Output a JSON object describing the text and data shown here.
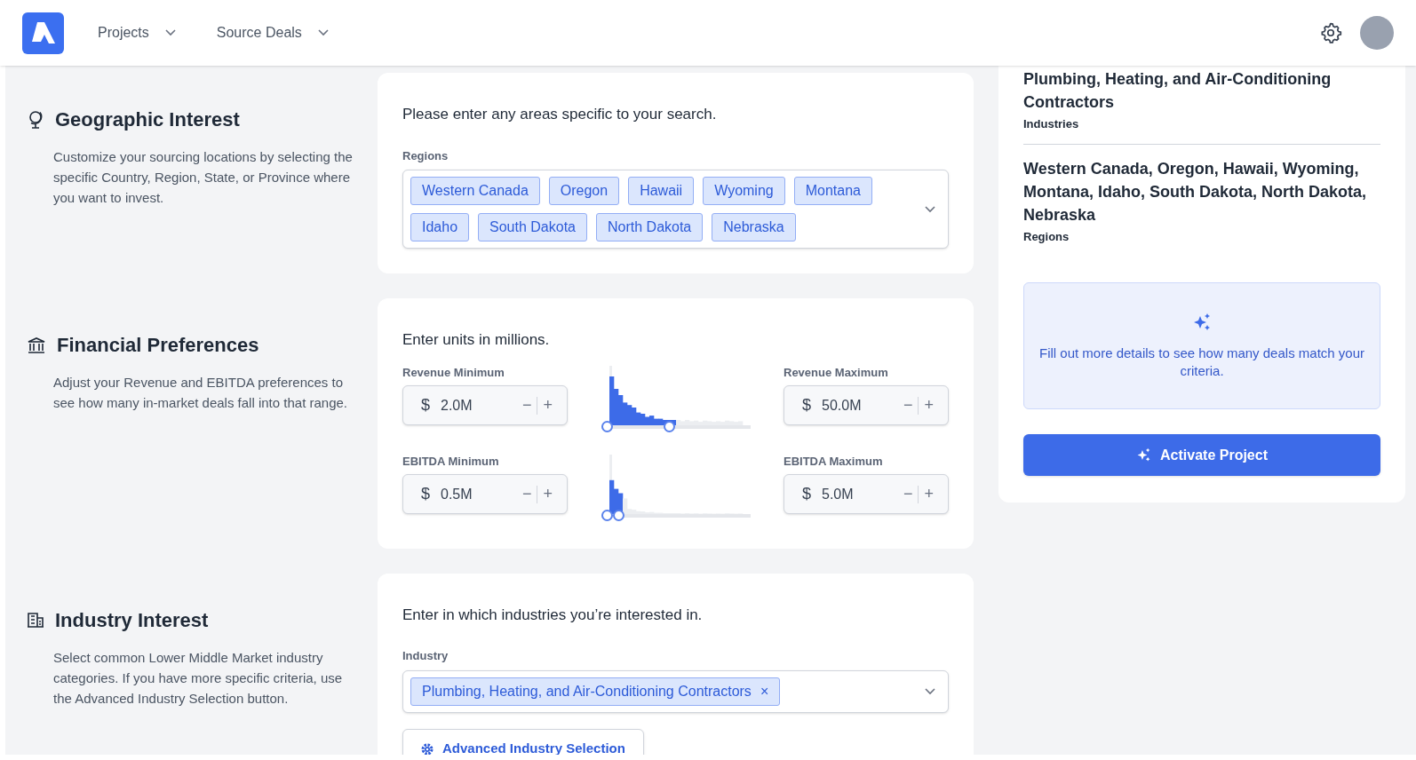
{
  "nav": {
    "items": [
      {
        "label": "Projects"
      },
      {
        "label": "Source Deals"
      }
    ]
  },
  "sections": [
    {
      "kind": "regions",
      "title": "Geographic Interest",
      "description": "Customize your sourcing locations by selecting the specific Country, Region, State, or Province where you want to invest.",
      "prompt": "Please enter any areas specific to your search.",
      "field_label": "Regions",
      "tags": [
        "Western Canada",
        "Oregon",
        "Hawaii",
        "Wyoming",
        "Montana",
        "Idaho",
        "South Dakota",
        "North Dakota",
        "Nebraska"
      ]
    },
    {
      "kind": "financial",
      "title": "Financial Preferences",
      "description": "Adjust your Revenue and EBITDA preferences to see how many in-market deals fall into that range.",
      "prompt": "Enter units in millions.",
      "currency": "$",
      "decrement": "−",
      "increment": "+",
      "rows": [
        {
          "min_label": "Revenue Minimum",
          "min_value": "2.0M",
          "max_label": "Revenue Maximum",
          "max_value": "50.0M",
          "range": {
            "start": {
              "level": 0
            },
            "end": {
              "level": 0.47
            }
          }
        },
        {
          "min_label": "EBITDA Minimum",
          "min_value": "0.5M",
          "max_label": "EBITDA Maximum",
          "max_value": "5.0M",
          "range": {
            "start": {
              "level": 0
            },
            "end": {
              "level": 0.09
            }
          }
        }
      ]
    },
    {
      "kind": "industry",
      "title": "Industry Interest",
      "description": "Select common Lower Middle Market industry categories. If you have more specific criteria, use the Advanced Industry Selection button.",
      "prompt": "Enter in which industries you’re interested in.",
      "field_label": "Industry",
      "tags": [
        "Plumbing, Heating, and Air-Conditioning Contractors"
      ],
      "tag_remove": "×",
      "button": "Advanced Industry Selection"
    }
  ],
  "summary": {
    "entries": [
      {
        "value": "Plumbing, Heating, and Air-Conditioning Contractors",
        "label": "Industries"
      },
      {
        "value": "Western Canada, Oregon, Hawaii, Wyoming, Montana, Idaho, South Dakota, North Dakota, Nebraska",
        "label": "Regions"
      }
    ],
    "hint": "Fill out more details to see how many deals match your criteria.",
    "button": "Activate Project"
  }
}
